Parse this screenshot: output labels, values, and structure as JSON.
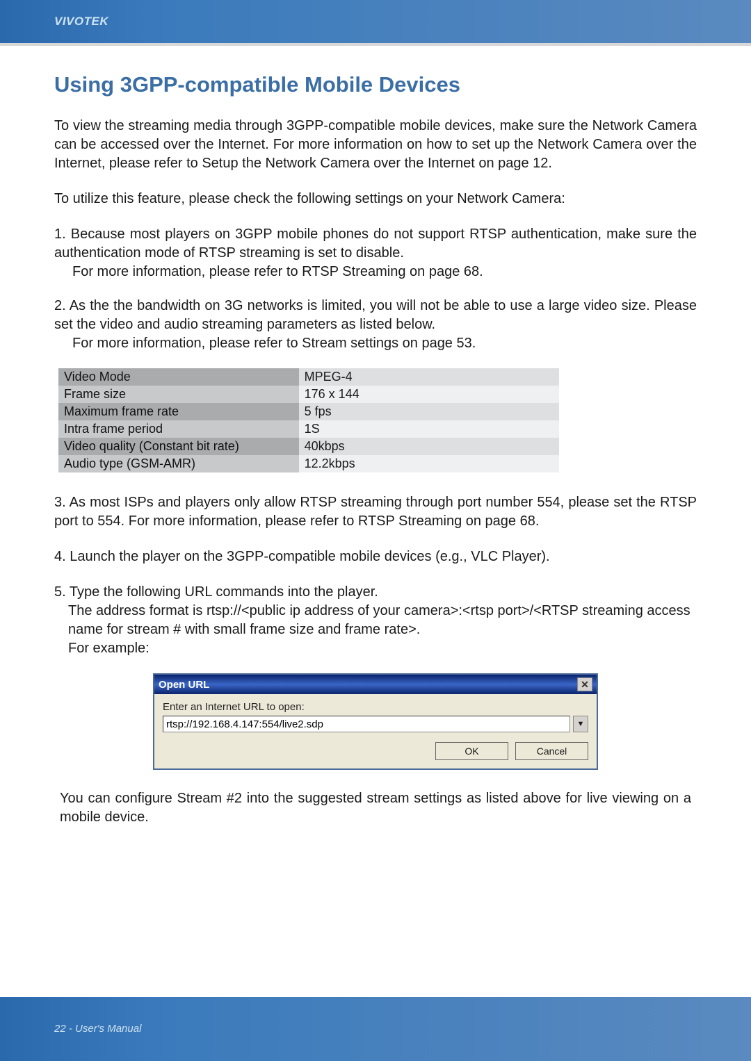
{
  "header": {
    "brand": "VIVOTEK"
  },
  "title": "Using 3GPP-compatible Mobile Devices",
  "para1": "To view the streaming media through 3GPP-compatible mobile devices, make sure the Network Camera can be accessed over the Internet. For more information on how to set up the Network Camera over the Internet, please refer to Setup the Network Camera over the Internet on page 12.",
  "para2": "To utilize this feature, please check the following settings on your Network Camera:",
  "item1_line1": "1. Because most players on 3GPP mobile phones do not support RTSP authentication, make sure the authentication mode of RTSP streaming is set to disable.",
  "item1_line2": "For more information, please refer to RTSP Streaming on page 68.",
  "item2_line1": "2. As the the bandwidth on 3G networks is limited, you will not be able to use a large video size. Please set the video and audio streaming parameters as listed below.",
  "item2_line2": "For more information, please refer to Stream settings on page 53.",
  "table": [
    {
      "k": "Video Mode",
      "v": "MPEG-4"
    },
    {
      "k": "Frame size",
      "v": "176 x 144"
    },
    {
      "k": "Maximum frame rate",
      "v": "5 fps"
    },
    {
      "k": "Intra frame period",
      "v": "1S"
    },
    {
      "k": "Video quality (Constant bit rate)",
      "v": "40kbps"
    },
    {
      "k": "Audio type (GSM-AMR)",
      "v": "12.2kbps"
    }
  ],
  "item3": "3. As most ISPs and players only allow RTSP streaming through port number 554, please set the RTSP port to 554. For more information, please refer to RTSP Streaming on page 68.",
  "item4": "4. Launch the player on the 3GPP-compatible mobile devices (e.g., VLC Player).",
  "item5_line1": "5. Type the following URL commands into the player.",
  "item5_line2": "The address format is rtsp://<public ip address of your camera>:<rtsp port>/<RTSP streaming access name for stream # with small frame size and frame rate>.",
  "item5_line3": "For example:",
  "dialog": {
    "title": "Open URL",
    "label": "Enter an Internet URL to open:",
    "value": "rtsp://192.168.4.147:554/live2.sdp",
    "ok": "OK",
    "cancel": "Cancel"
  },
  "closing": "You can configure Stream #2 into the suggested stream settings as listed above for live viewing on a mobile device.",
  "footer": "22 - User's Manual"
}
